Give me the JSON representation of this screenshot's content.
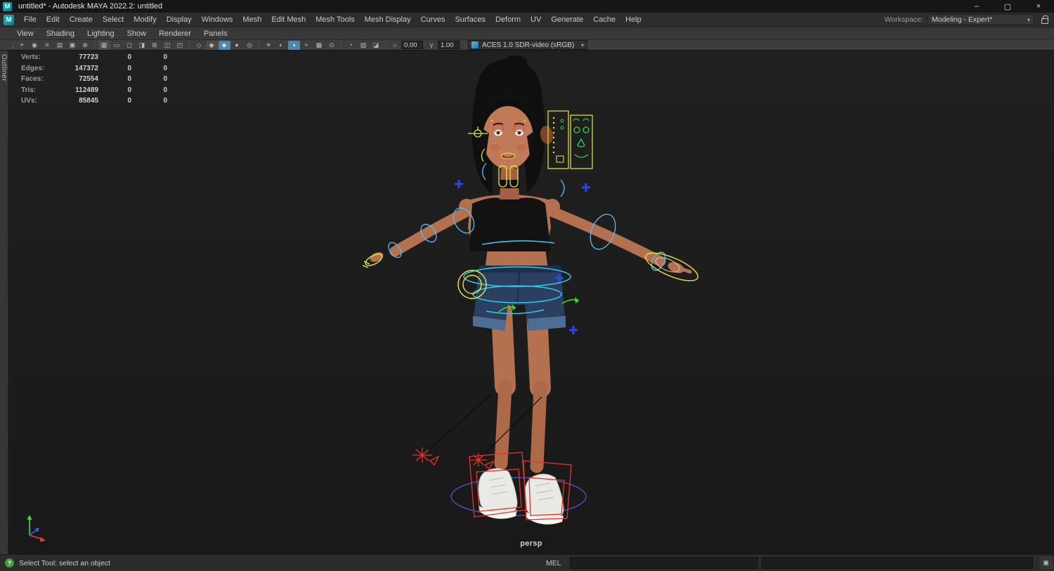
{
  "window": {
    "title": "untitled* - Autodesk MAYA 2022.2: untitled",
    "app_initial": "M"
  },
  "menu_bar": {
    "items": [
      "File",
      "Edit",
      "Create",
      "Select",
      "Modify",
      "Display",
      "Windows",
      "Mesh",
      "Edit Mesh",
      "Mesh Tools",
      "Mesh Display",
      "Curves",
      "Surfaces",
      "Deform",
      "UV",
      "Generate",
      "Cache",
      "Help"
    ],
    "workspace_label": "Workspace:",
    "workspace_value": "Modeling - Expert*"
  },
  "panel_menu": {
    "items": [
      "View",
      "Shading",
      "Lighting",
      "Show",
      "Renderer",
      "Panels"
    ]
  },
  "panel_toolbar": {
    "exposure": "0.00",
    "gamma": "1.00",
    "view_transform": "ACES 1.0 SDR-video (sRGB)"
  },
  "side_tab": {
    "label": "Outliner"
  },
  "hud": {
    "rows": [
      {
        "label": "Verts:",
        "value": "77723",
        "sel": "0",
        "other": "0"
      },
      {
        "label": "Edges:",
        "value": "147372",
        "sel": "0",
        "other": "0"
      },
      {
        "label": "Faces:",
        "value": "72554",
        "sel": "0",
        "other": "0"
      },
      {
        "label": "Tris:",
        "value": "112489",
        "sel": "0",
        "other": "0"
      },
      {
        "label": "UVs:",
        "value": "85845",
        "sel": "0",
        "other": "0"
      }
    ]
  },
  "viewport": {
    "camera": "persp"
  },
  "status_bar": {
    "tool_help": "Select Tool: select an object",
    "mel_label": "MEL"
  },
  "icons": {
    "minimize": "–",
    "maximize": "▢",
    "close": "×",
    "chevron": "▾",
    "help": "?",
    "grip": "⋮",
    "select_camera": "⌖",
    "lock_camera": "◉",
    "camera_attrs": "≡",
    "bookmarks": "▤",
    "image_plane": "▣",
    "pan_zoom": "⊕",
    "grid": "▦",
    "film_gate": "▭",
    "res_gate": "◻",
    "gate_mask": "◨",
    "field_chart": "⊞",
    "safe_action": "◫",
    "safe_title": "◰",
    "wireframe": "◇",
    "smooth_shade": "◆",
    "textured": "◈",
    "default_material": "●",
    "wireframe_on_shaded": "◎",
    "lights": "☀",
    "shadows": "◐",
    "ao": "◑",
    "motion_blur": "≈",
    "aa": "▩",
    "dof": "⊙",
    "isolate": "◔",
    "xray": "▨",
    "xray_joints": "◪",
    "exposure": "☼",
    "gamma": "γ",
    "script_editor": "▣"
  },
  "colors": {
    "active_toggle": "#5285a6",
    "maya_teal": "#14a5b8",
    "platform_blue": "#4a5ac8",
    "rig_yellow": "#e8e838",
    "rig_cyan": "#38c8ec",
    "rig_red": "#e83228",
    "rig_green": "#2ed052",
    "viewport_bg": "#1c1c1c"
  }
}
